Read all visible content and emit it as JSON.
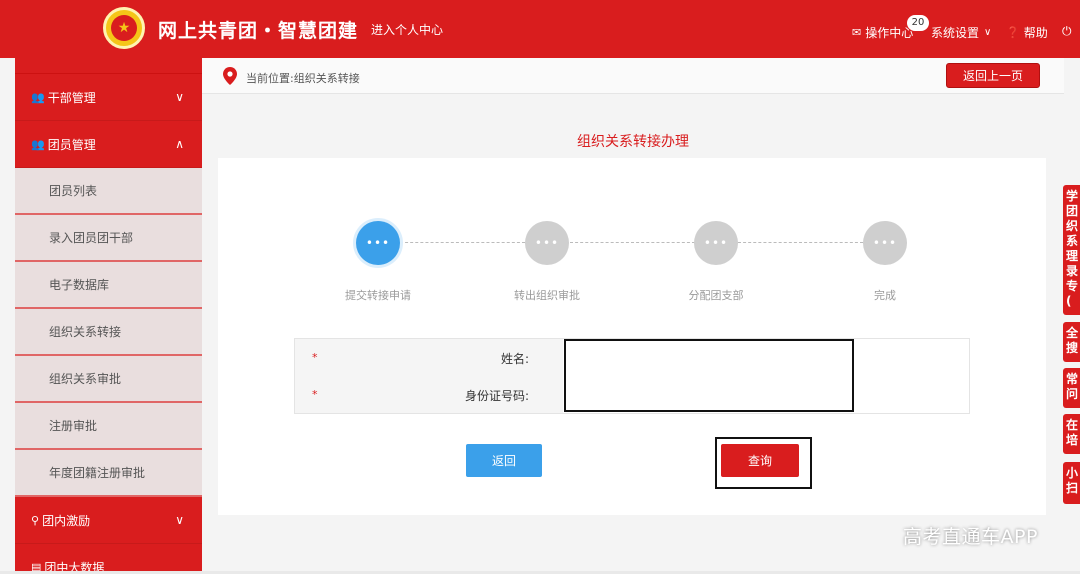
{
  "header": {
    "site_title": "网上共青团・智慧团建",
    "personal_center": "进入个人中心",
    "ops_center": "操作中心",
    "ops_badge": "20",
    "settings": "系统设置",
    "help": "帮助",
    "logout_icon": "power-icon"
  },
  "sidebar": {
    "groups": [
      {
        "label": "干部管理",
        "icon": "users-icon",
        "expanded": false
      },
      {
        "label": "团员管理",
        "icon": "users-icon",
        "expanded": true
      },
      {
        "label": "团内激励",
        "icon": "hierarchy-icon",
        "expanded": false
      },
      {
        "label": "团中大数据",
        "icon": "data-icon",
        "expanded": false
      }
    ],
    "items": [
      "团员列表",
      "录入团员团干部",
      "电子数据库",
      "组织关系转接",
      "组织关系审批",
      "注册审批",
      "年度团籍注册审批"
    ]
  },
  "breadcrumb": {
    "text": "当前位置:组织关系转接",
    "back_button": "返回上一页"
  },
  "page_title": "组织关系转接办理",
  "steps": [
    {
      "label": "提交转接申请",
      "active": true
    },
    {
      "label": "转出组织审批",
      "active": false
    },
    {
      "label": "分配团支部",
      "active": false
    },
    {
      "label": "完成",
      "active": false
    }
  ],
  "step_dots": "•••",
  "form": {
    "required_mark": "*",
    "name_label": "姓名:",
    "name_value": "",
    "id_label": "身份证号码:",
    "id_value": ""
  },
  "buttons": {
    "back": "返回",
    "query": "查询"
  },
  "float_tabs": [
    "学团织系理录专(",
    "全搜",
    "常问",
    "在培",
    "小扫"
  ],
  "watermark": "高考直通车APP",
  "colors": {
    "primary_red": "#d91d1e",
    "step_blue": "#3ba0ea",
    "step_grey": "#cfcfcf"
  }
}
